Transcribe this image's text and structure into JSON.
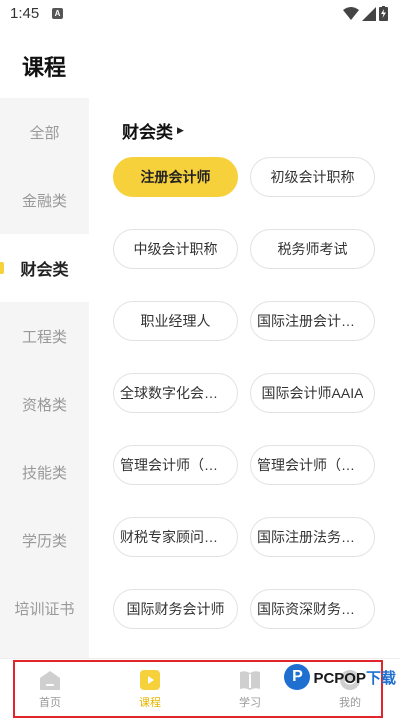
{
  "status": {
    "time": "1:45",
    "notif_icon": "A"
  },
  "page_title": "课程",
  "sidebar": {
    "items": [
      {
        "label": "全部"
      },
      {
        "label": "金融类"
      },
      {
        "label": "财会类",
        "active": true
      },
      {
        "label": "工程类"
      },
      {
        "label": "资格类"
      },
      {
        "label": "技能类"
      },
      {
        "label": "学历类"
      },
      {
        "label": "培训证书"
      }
    ]
  },
  "section": {
    "title": "财会类",
    "chips": [
      "注册会计师",
      "初级会计职称",
      "中级会计职称",
      "税务师考试",
      "职业经理人",
      "国际注册会计师IC...",
      "全球数字化会计师...",
      "国际会计师AAIA",
      "管理会计师（中级...",
      "管理会计师（高级...",
      "财税专家顾问聘书",
      "国际注册法务会计...",
      "国际财务会计师",
      "国际资深财务会计..."
    ],
    "selected_index": 0
  },
  "tabbar": {
    "tabs": [
      {
        "label": "首页",
        "icon": "home-icon"
      },
      {
        "label": "课程",
        "icon": "play-icon",
        "active": true
      },
      {
        "label": "学习",
        "icon": "book-icon"
      },
      {
        "label": "我的",
        "icon": "profile-icon"
      }
    ]
  },
  "watermark": {
    "logo": "P",
    "brand": "PCPOP",
    "suffix": "下载"
  },
  "colors": {
    "accent": "#f7d13c",
    "highlight": "#e0262b",
    "brand": "#1f6fd1"
  }
}
